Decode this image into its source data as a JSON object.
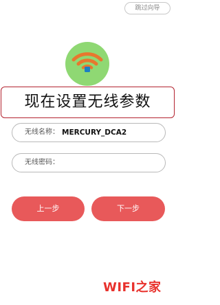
{
  "header": {
    "skip_label": "跳过向导"
  },
  "page": {
    "title": "现在设置无线参数"
  },
  "form": {
    "ssid_label": "无线名称：",
    "ssid_value": "MERCURY_DCA2",
    "password_label": "无线密码：",
    "password_value": ""
  },
  "buttons": {
    "prev_label": "上一步",
    "next_label": "下一步"
  },
  "watermark": {
    "text": "WIFI之家"
  },
  "colors": {
    "accent_button": "#e8595a",
    "icon_circle": "#8fd873",
    "wifi_arcs": "#e8772e",
    "wifi_dot": "#1c7fc4",
    "title_border": "#b3222e",
    "watermark": "#e8322d"
  },
  "icons": {
    "wifi": "wifi-icon"
  }
}
